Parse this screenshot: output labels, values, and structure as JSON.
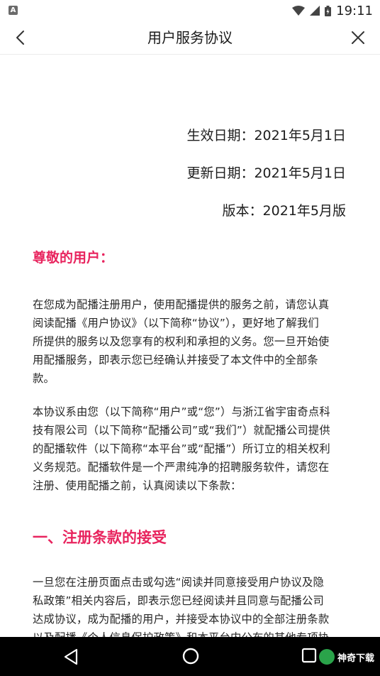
{
  "status_bar": {
    "left_icon": "A",
    "time": "19:11",
    "icons": [
      "wifi-icon",
      "signal-icon",
      "battery-icon"
    ]
  },
  "header": {
    "title": "用户服务协议",
    "back_icon": "chevron-left-icon",
    "close_icon": "close-icon"
  },
  "document": {
    "effective_date": "生效日期：2021年5月1日",
    "updated_date": "更新日期：2021年5月1日",
    "version": "版本：2021年5月版",
    "greeting": "尊敬的用户：",
    "paragraph1": [
      "在您成为配播注册用户，使用配播提供的服务之前，请您认真",
      "阅读配播《用户协议》（以下简称“协议”），更好地了解我们",
      "所提供的服务以及您享有的权利和承担的义务。您一旦开始使",
      "用配播服务，即表示您已经确认并接受了本文件中的全部条",
      "款。"
    ],
    "paragraph2": [
      "本协议系由您（以下简称“用户”或“您”）与浙江省宇宙奇点科",
      "技有限公司（以下简称“配播公司”或“我们”）就配播公司提供",
      "的配播软件（以下简称“本平台”或“配播”）所订立的相关权利",
      "义务规范。配播软件是一个严肃纯净的招聘服务软件，请您在",
      "注册、使用配播之前，认真阅读以下条款："
    ],
    "section1_title": "一、注册条款的接受",
    "paragraph3": [
      "一旦您在注册页面点击或勾选“阅读并同意接受用户协议及隐",
      "私政策”相关内容后，即表示您已经阅读并且同意与配播公司",
      "达成协议，成为配播的用户，并接受本协议中的全部注册条款",
      "以及配播《个人信息保护政策》和本平台内公布的其他专项协"
    ]
  },
  "nav_bar": {
    "back_icon": "nav-back-icon",
    "home_icon": "nav-home-icon",
    "recents_icon": "nav-recents-icon",
    "watermark": "神奇下载"
  },
  "colors": {
    "accent": "#e8245e",
    "text": "#262626",
    "nav_background": "#000000"
  }
}
